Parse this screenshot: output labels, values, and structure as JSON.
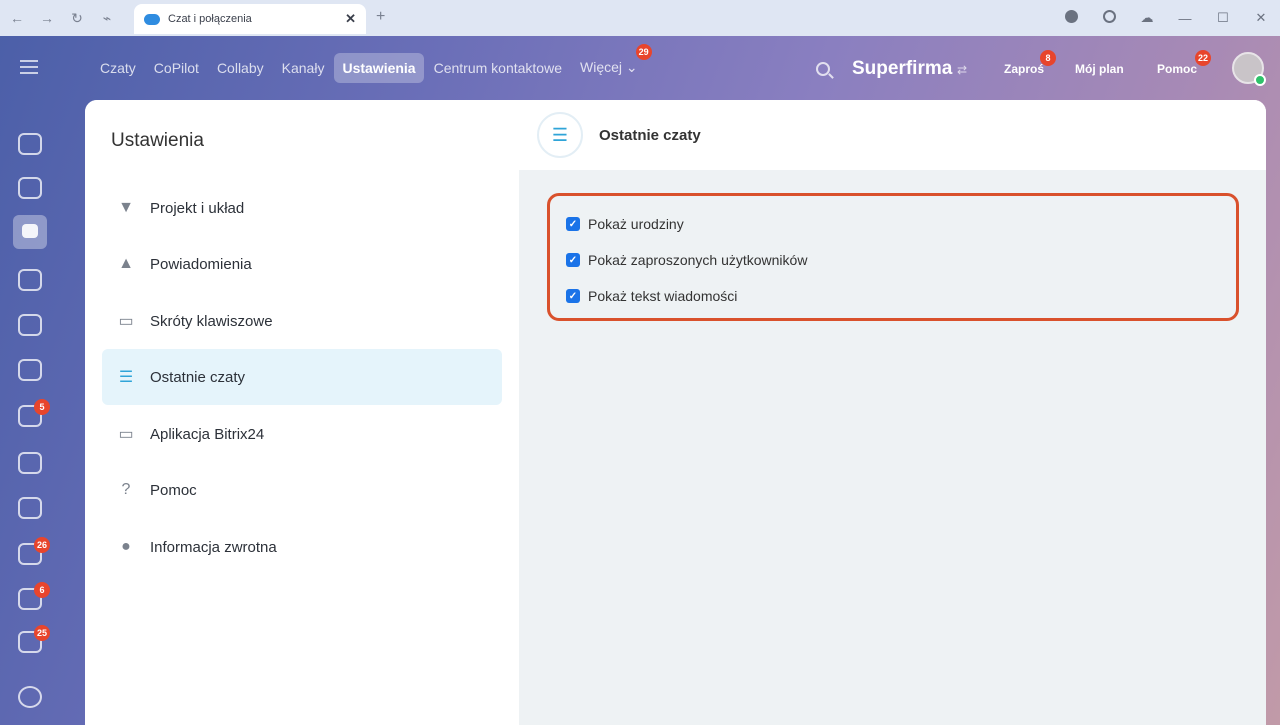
{
  "browser": {
    "tab_title": "Czat i połączenia",
    "close_glyph": "✕",
    "new_tab_glyph": "+"
  },
  "topbar": {
    "menu": [
      {
        "label": "Czaty"
      },
      {
        "label": "CoPilot"
      },
      {
        "label": "Collaby"
      },
      {
        "label": "Kanały"
      },
      {
        "label": "Ustawienia",
        "active": true
      },
      {
        "label": "Centrum kontaktowe"
      },
      {
        "label": "Więcej",
        "badge": "29"
      }
    ],
    "company": "Superfirma",
    "links": {
      "invite": "Zaproś",
      "invite_badge": "8",
      "plan": "Mój plan",
      "help": "Pomoc",
      "help_badge": "22"
    }
  },
  "leftbar": {
    "badges": {
      "mail": "5",
      "tasks": "26",
      "inbox": "6",
      "funnel": "25"
    }
  },
  "settings": {
    "title": "Ustawienia",
    "items": [
      {
        "label": "Projekt i układ",
        "icon": "brush-icon"
      },
      {
        "label": "Powiadomienia",
        "icon": "bell-icon"
      },
      {
        "label": "Skróty klawiszowe",
        "icon": "keyboard-icon"
      },
      {
        "label": "Ostatnie czaty",
        "icon": "list-icon",
        "selected": true
      },
      {
        "label": "Aplikacja Bitrix24",
        "icon": "monitor-icon"
      },
      {
        "label": "Pomoc",
        "icon": "question-icon"
      },
      {
        "label": "Informacja zwrotna",
        "icon": "chat-bubble-icon"
      }
    ]
  },
  "content": {
    "title": "Ostatnie czaty",
    "options": [
      {
        "label": "Pokaż urodziny",
        "checked": true
      },
      {
        "label": "Pokaż zaproszonych użytkowników",
        "checked": true
      },
      {
        "label": "Pokaż tekst wiadomości",
        "checked": true
      }
    ],
    "highlight_color": "#d9512c"
  }
}
